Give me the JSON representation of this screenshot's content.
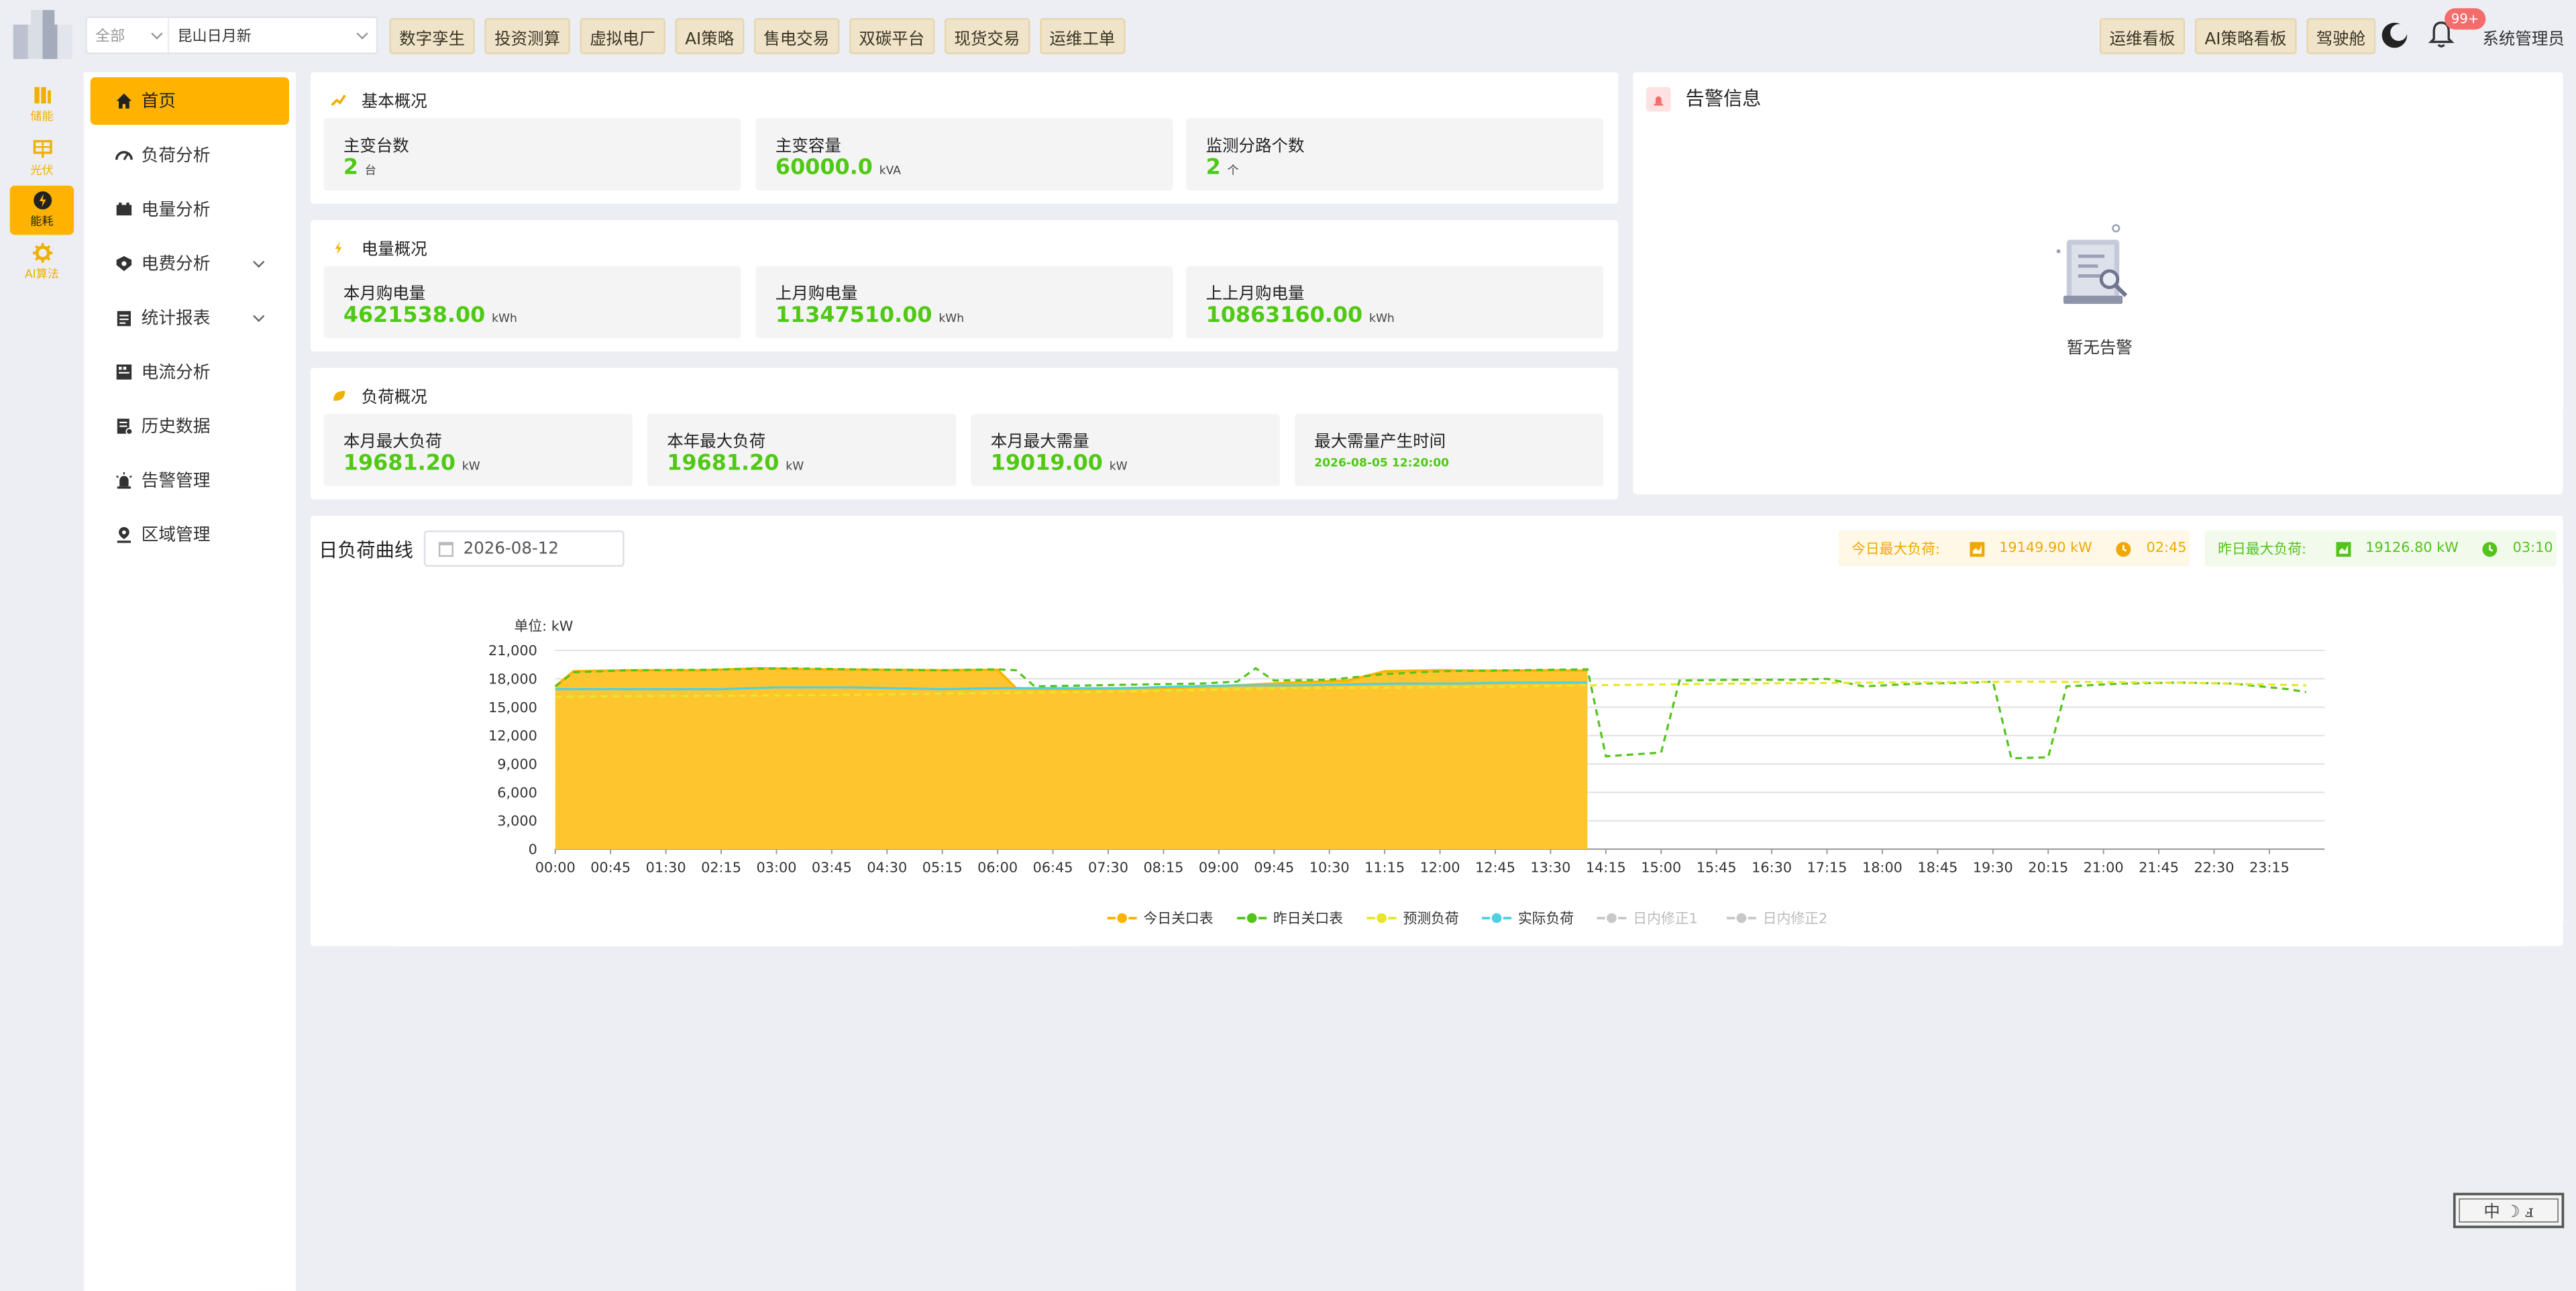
{
  "topbar": {
    "scope_primary": "全部",
    "scope_secondary": "昆山日月新",
    "nav": [
      "数字孪生",
      "投资测算",
      "虚拟电厂",
      "AI策略",
      "售电交易",
      "双碳平台",
      "现货交易",
      "运维工单"
    ],
    "right_nav": [
      "运维看板",
      "AI策略看板",
      "驾驶舱"
    ],
    "notification_badge": "99+",
    "user_name": "系统管理员"
  },
  "rail": [
    {
      "label": "储能",
      "icon": "battery-icon",
      "active": false
    },
    {
      "label": "光伏",
      "icon": "solar-panel-icon",
      "active": false
    },
    {
      "label": "能耗",
      "icon": "lightning-icon",
      "active": true
    },
    {
      "label": "AI算法",
      "icon": "gear-icon",
      "active": false
    }
  ],
  "menu": [
    {
      "label": "首页",
      "icon": "home-icon",
      "active": true,
      "expandable": false
    },
    {
      "label": "负荷分析",
      "icon": "gauge-icon",
      "active": false,
      "expandable": false
    },
    {
      "label": "电量分析",
      "icon": "battery-icon",
      "active": false,
      "expandable": false
    },
    {
      "label": "电费分析",
      "icon": "shield-icon",
      "active": false,
      "expandable": true
    },
    {
      "label": "统计报表",
      "icon": "clipboard-icon",
      "active": false,
      "expandable": true
    },
    {
      "label": "电流分析",
      "icon": "grid-icon",
      "active": false,
      "expandable": false
    },
    {
      "label": "历史数据",
      "icon": "document-icon",
      "active": false,
      "expandable": false
    },
    {
      "label": "告警管理",
      "icon": "siren-icon",
      "active": false,
      "expandable": false
    },
    {
      "label": "区域管理",
      "icon": "location-icon",
      "active": false,
      "expandable": false
    }
  ],
  "basic": {
    "title": "基本概况",
    "stats": [
      {
        "label": "主变台数",
        "value": "2",
        "unit": "台"
      },
      {
        "label": "主变容量",
        "value": "60000.0",
        "unit": "kVA"
      },
      {
        "label": "监测分路个数",
        "value": "2",
        "unit": "个"
      }
    ]
  },
  "energy": {
    "title": "电量概况",
    "stats": [
      {
        "label": "本月购电量",
        "value": "4621538.00",
        "unit": "kWh"
      },
      {
        "label": "上月购电量",
        "value": "11347510.00",
        "unit": "kWh"
      },
      {
        "label": "上上月购电量",
        "value": "10863160.00",
        "unit": "kWh"
      }
    ]
  },
  "load": {
    "title": "负荷概况",
    "stats": [
      {
        "label": "本月最大负荷",
        "value": "19681.20",
        "unit": "kW"
      },
      {
        "label": "本年最大负荷",
        "value": "19681.20",
        "unit": "kW"
      },
      {
        "label": "本月最大需量",
        "value": "19019.00",
        "unit": "kW"
      },
      {
        "label": "最大需量产生时间",
        "value": "2026-08-05 12:20:00",
        "unit": ""
      }
    ]
  },
  "alarm": {
    "title": "告警信息",
    "empty_text": "暂无告警"
  },
  "daily": {
    "title": "日负荷曲线",
    "date": "2026-08-12",
    "today_label": "今日最大负荷:",
    "today_value": "19149.90 kW",
    "today_time": "02:45",
    "yest_label": "昨日最大负荷:",
    "yest_value": "19126.80 kW",
    "yest_time": "03:10"
  },
  "colors": {
    "accent": "#ffb300",
    "green": "#4fc914",
    "today": "#ffb300",
    "yesterday": "#52c41a",
    "forecast": "#e6e62a",
    "actual": "#4dd0e1"
  },
  "chart_data": {
    "type": "area",
    "ylabel": "单位: kW",
    "ylim": [
      0,
      21000
    ],
    "yticks": [
      0,
      3000,
      6000,
      9000,
      12000,
      15000,
      18000,
      21000
    ],
    "xtick_labels": [
      "00:00",
      "00:45",
      "01:30",
      "02:15",
      "03:00",
      "03:45",
      "04:30",
      "05:15",
      "06:00",
      "06:45",
      "07:30",
      "08:15",
      "09:00",
      "09:45",
      "10:30",
      "11:15",
      "12:00",
      "12:45",
      "13:30",
      "14:15",
      "15:00",
      "15:45",
      "16:30",
      "17:15",
      "18:00",
      "18:45",
      "19:30",
      "20:15",
      "21:00",
      "21:45",
      "22:30",
      "23:15"
    ],
    "grid": true,
    "legend_position": "bottom",
    "series": [
      {
        "name": "今日关口表",
        "color": "#ffb300",
        "style": "area",
        "points": [
          [
            "00:00",
            17200
          ],
          [
            "00:15",
            18800
          ],
          [
            "01:00",
            18900
          ],
          [
            "02:00",
            18900
          ],
          [
            "02:45",
            19100
          ],
          [
            "03:30",
            19000
          ],
          [
            "04:30",
            18950
          ],
          [
            "05:15",
            18900
          ],
          [
            "06:00",
            18950
          ],
          [
            "06:15",
            17000
          ],
          [
            "07:00",
            16900
          ],
          [
            "07:45",
            17000
          ],
          [
            "08:30",
            17100
          ],
          [
            "09:15",
            17300
          ],
          [
            "10:00",
            17600
          ],
          [
            "10:45",
            17800
          ],
          [
            "11:15",
            18800
          ],
          [
            "12:00",
            18900
          ],
          [
            "12:45",
            18850
          ],
          [
            "13:30",
            18900
          ],
          [
            "14:00",
            18850
          ]
        ]
      },
      {
        "name": "昨日关口表",
        "color": "#52c41a",
        "style": "dashed",
        "points": [
          [
            "00:00",
            17200
          ],
          [
            "00:15",
            18700
          ],
          [
            "01:00",
            18900
          ],
          [
            "02:00",
            18950
          ],
          [
            "03:10",
            19100
          ],
          [
            "04:00",
            19000
          ],
          [
            "05:15",
            18900
          ],
          [
            "06:00",
            19000
          ],
          [
            "06:15",
            18900
          ],
          [
            "06:30",
            17200
          ],
          [
            "07:15",
            17300
          ],
          [
            "08:00",
            17400
          ],
          [
            "08:45",
            17500
          ],
          [
            "09:15",
            17700
          ],
          [
            "09:30",
            19100
          ],
          [
            "09:45",
            17800
          ],
          [
            "10:30",
            17900
          ],
          [
            "11:15",
            18500
          ],
          [
            "12:00",
            18800
          ],
          [
            "13:00",
            18900
          ],
          [
            "14:00",
            19000
          ],
          [
            "14:15",
            9800
          ],
          [
            "15:00",
            10200
          ],
          [
            "15:15",
            17800
          ],
          [
            "16:00",
            17900
          ],
          [
            "16:45",
            17900
          ],
          [
            "17:15",
            18000
          ],
          [
            "17:45",
            17200
          ],
          [
            "18:30",
            17500
          ],
          [
            "19:15",
            17600
          ],
          [
            "19:30",
            17700
          ],
          [
            "19:45",
            9600
          ],
          [
            "20:15",
            9700
          ],
          [
            "20:30",
            17200
          ],
          [
            "21:15",
            17500
          ],
          [
            "22:00",
            17600
          ],
          [
            "22:45",
            17500
          ],
          [
            "23:30",
            16900
          ],
          [
            "23:45",
            16600
          ]
        ]
      },
      {
        "name": "预测负荷",
        "color": "#e6e62a",
        "style": "dashed",
        "points": [
          [
            "00:00",
            16100
          ],
          [
            "02:00",
            16200
          ],
          [
            "04:00",
            16300
          ],
          [
            "06:00",
            16500
          ],
          [
            "08:00",
            16700
          ],
          [
            "10:00",
            17000
          ],
          [
            "12:00",
            17100
          ],
          [
            "14:00",
            17300
          ],
          [
            "16:00",
            17500
          ],
          [
            "18:00",
            17600
          ],
          [
            "20:00",
            17700
          ],
          [
            "22:00",
            17600
          ],
          [
            "23:45",
            17300
          ]
        ]
      },
      {
        "name": "实际负荷",
        "color": "#4dd0e1",
        "style": "line",
        "points": [
          [
            "00:00",
            16900
          ],
          [
            "01:00",
            16900
          ],
          [
            "02:15",
            16900
          ],
          [
            "03:00",
            17100
          ],
          [
            "04:00",
            17100
          ],
          [
            "05:15",
            16900
          ],
          [
            "06:00",
            17000
          ],
          [
            "06:45",
            17000
          ],
          [
            "07:45",
            17000
          ],
          [
            "08:30",
            17200
          ],
          [
            "09:15",
            17300
          ],
          [
            "10:00",
            17300
          ],
          [
            "10:45",
            17400
          ],
          [
            "11:30",
            17500
          ],
          [
            "12:15",
            17500
          ],
          [
            "13:00",
            17600
          ],
          [
            "14:00",
            17600
          ]
        ]
      },
      {
        "name": "日内修正1",
        "color": "#c8c8c8",
        "style": "hidden",
        "points": []
      },
      {
        "name": "日内修正2",
        "color": "#c8c8c8",
        "style": "hidden",
        "points": []
      }
    ]
  }
}
